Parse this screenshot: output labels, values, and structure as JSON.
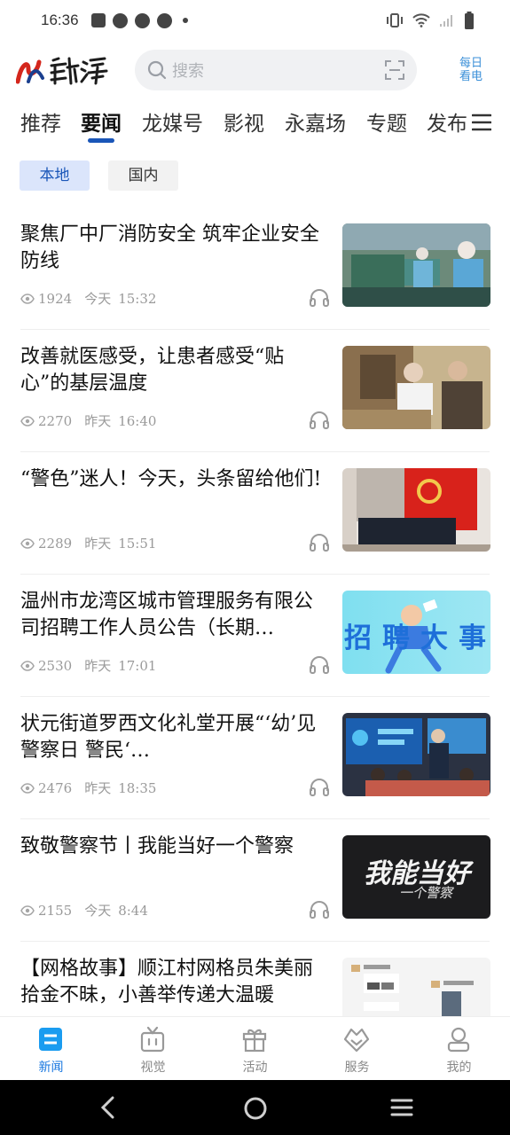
{
  "status_bar": {
    "time": "16:36"
  },
  "header": {
    "search_placeholder": "搜索",
    "daily_label_line1": "每日",
    "daily_label_line2": "看电"
  },
  "tabs": [
    {
      "label": "推荐"
    },
    {
      "label": "要闻",
      "active": true
    },
    {
      "label": "龙媒号"
    },
    {
      "label": "影视"
    },
    {
      "label": "永嘉场"
    },
    {
      "label": "专题"
    },
    {
      "label": "发布"
    }
  ],
  "sub_tabs": [
    {
      "label": "本地",
      "active": true
    },
    {
      "label": "国内"
    }
  ],
  "articles": [
    {
      "title": "聚焦厂中厂消防安全  筑牢企业安全防线",
      "views": "1924",
      "day": "今天",
      "time": "15:32",
      "image": "factory-workers-photo"
    },
    {
      "title": "改善就医感受，让患者感受“贴心”的基层温度",
      "views": "2270",
      "day": "昨天",
      "time": "16:40",
      "image": "doctor-patient-photo"
    },
    {
      "title": "“警色”迷人！今天，头条留给他们!",
      "views": "2289",
      "day": "昨天",
      "time": "15:51",
      "image": "police-ceremony-photo"
    },
    {
      "title": "温州市龙湾区城市管理服务有限公司招聘工作人员公告（长期…",
      "views": "2530",
      "day": "昨天",
      "time": "17:01",
      "image": "recruitment-banner",
      "image_text": "招聘大事"
    },
    {
      "title": "状元街道罗西文化礼堂开展“‘幼’见警察日  警民‘…",
      "views": "2476",
      "day": "昨天",
      "time": "18:35",
      "image": "children-police-screen-photo"
    },
    {
      "title": "致敬警察节丨我能当好一个警察",
      "views": "2155",
      "day": "今天",
      "time": "8:44",
      "image": "police-day-title-card",
      "image_text": "我能当好",
      "image_subtext": "一个警察"
    },
    {
      "title": "【网格故事】顺江村网格员朱美丽拾金不昧，小善举传递大温暖",
      "image": "chat-screenshot-image"
    }
  ],
  "bottom_nav": [
    {
      "label": "新闻",
      "icon": "news-icon",
      "active": true
    },
    {
      "label": "视觉",
      "icon": "tv-icon"
    },
    {
      "label": "活动",
      "icon": "gift-icon"
    },
    {
      "label": "服务",
      "icon": "service-heart-icon"
    },
    {
      "label": "我的",
      "icon": "profile-icon"
    }
  ],
  "colors": {
    "accent": "#1a56b8",
    "nav_active": "#1a78e0",
    "meta_gray": "#9a9a9a"
  }
}
